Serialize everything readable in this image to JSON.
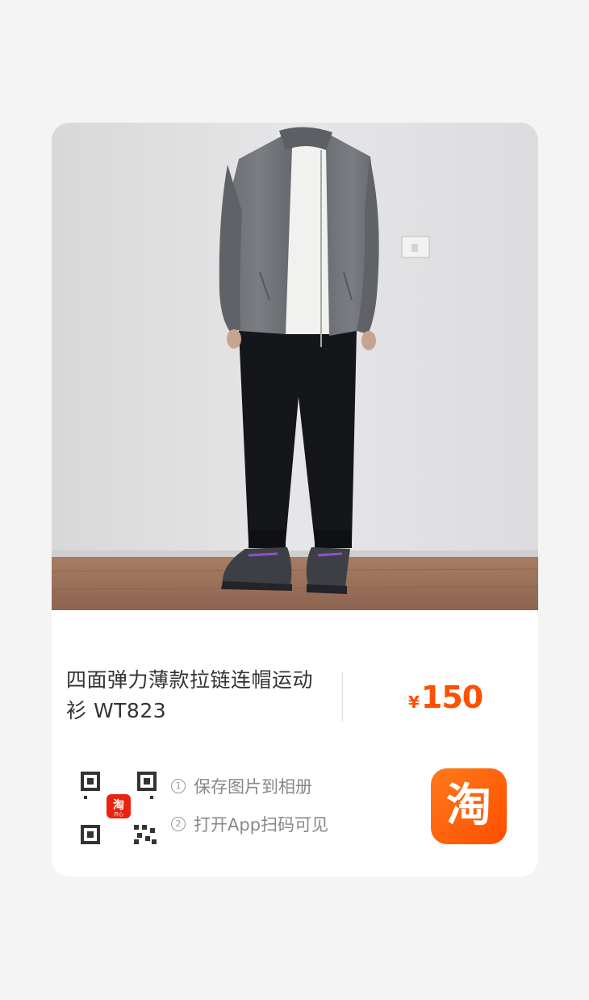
{
  "product": {
    "title": "四面弹力薄款拉链连帽运动衫 WT823",
    "price_symbol": "¥",
    "price": "150"
  },
  "steps": [
    {
      "num": "1",
      "text": "保存图片到相册"
    },
    {
      "num": "2",
      "text": "打开App扫码可见"
    }
  ],
  "qr": {
    "center_logo_text": "淘",
    "center_logo_subtext": "开心"
  },
  "taobao_button": {
    "glyph": "淘"
  },
  "colors": {
    "accent": "#ff5000",
    "page_background": "#f4f4f4",
    "card_background": "#ffffff"
  },
  "icons": {
    "qr": "qr-code-icon",
    "app": "taobao-app-icon"
  }
}
